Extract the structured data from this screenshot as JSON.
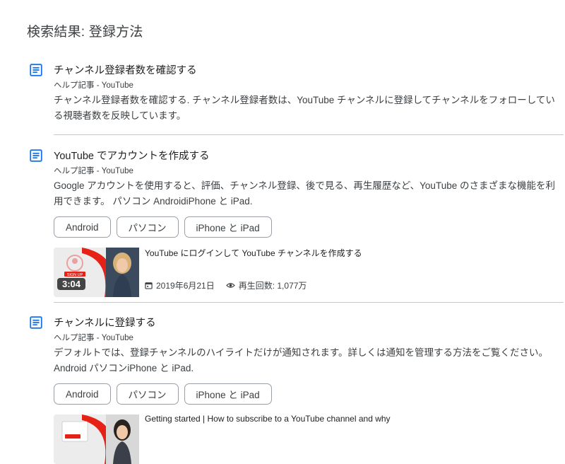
{
  "page": {
    "title": "検索結果: 登録方法"
  },
  "results": [
    {
      "title": "チャンネル登録者数を確認する",
      "source": "ヘルプ記事 - YouTube",
      "snippet": "チャンネル登録者数を確認する. チャンネル登録者数は、YouTube チャンネルに登録してチャンネルをフォローしている視聴者数を反映しています。"
    },
    {
      "title": "YouTube でアカウントを作成する",
      "source": "ヘルプ記事 - YouTube",
      "snippet": "Google アカウントを使用すると、評価、チャンネル登録、後で見る、再生履歴など、YouTube のさまざまな機能を利用できます。 パソコン AndroidiPhone と iPad.",
      "chips": [
        "Android",
        "パソコン",
        "iPhone と iPad"
      ],
      "video": {
        "title": "YouTube にログインして YouTube チャンネルを作成する",
        "duration": "3:04",
        "date": "2019年6月21日",
        "views": "再生回数: 1,077万",
        "thumb_badge": "SIGN UP"
      }
    },
    {
      "title": "チャンネルに登録する",
      "source": "ヘルプ記事 - YouTube",
      "snippet": "デフォルトでは、登録チャンネルのハイライトだけが通知されます。詳しくは通知を管理する方法をご覧ください。 Android パソコンiPhone と iPad.",
      "chips": [
        "Android",
        "パソコン",
        "iPhone と iPad"
      ],
      "video": {
        "title": "Getting started | How to subscribe to a YouTube channel and why"
      }
    }
  ],
  "colors": {
    "doc_icon": "#1a73e8",
    "youtube_red": "#e62117"
  }
}
